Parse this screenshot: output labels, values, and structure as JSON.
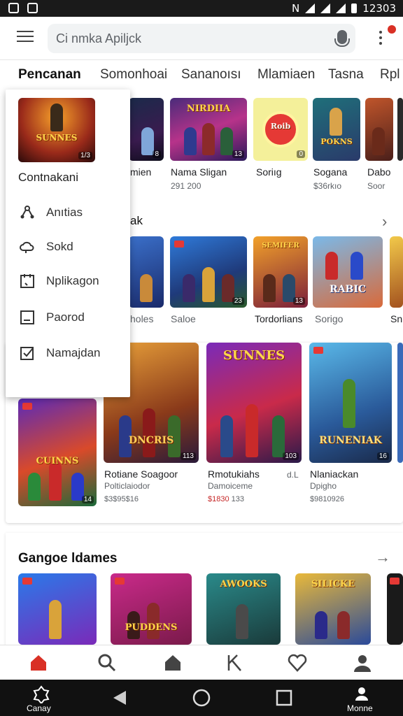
{
  "status_bar": {
    "time": "12303",
    "network": "N"
  },
  "search": {
    "placeholder": "Ci nmka Apiljck"
  },
  "tabs": [
    {
      "label": "Pencanan",
      "active": true
    },
    {
      "label": "Somonhoai"
    },
    {
      "label": "Sananoısı"
    },
    {
      "label": "Mlamiaen"
    },
    {
      "label": "Tasna"
    },
    {
      "label": "Rpl"
    }
  ],
  "popup_menu": {
    "featured_title": "SUNNES",
    "featured_tag": "1/3",
    "title": "Contnakani",
    "items": [
      {
        "label": "Anıtias",
        "icon": "share-icon"
      },
      {
        "label": "Sokd",
        "icon": "cloud-icon"
      },
      {
        "label": "Nplikagon",
        "icon": "calendar-icon"
      },
      {
        "label": "Paorod",
        "icon": "tablet-icon"
      },
      {
        "label": "Namajdan",
        "icon": "checkbox-icon"
      }
    ]
  },
  "row1": [
    {
      "title": "",
      "tag": "8",
      "name": "mien",
      "sub": ""
    },
    {
      "title": "NIRDIIA",
      "tag": "13",
      "name": "Nama Sligan",
      "sub": "291 200"
    },
    {
      "title": "Roib",
      "tag": "0",
      "name": "Soriıg",
      "sub": ""
    },
    {
      "title": "POKNS",
      "tag": "",
      "name": "Sogana",
      "sub": "$36rkıo"
    },
    {
      "title": "",
      "tag": "",
      "name": "Dabo",
      "sub": "Soor"
    }
  ],
  "row2": {
    "header": "ak",
    "items": [
      {
        "title": "",
        "tag": "",
        "name": "holes"
      },
      {
        "title": "",
        "tag": "23",
        "name": "Saloe"
      },
      {
        "title": "SEMIFER",
        "tag": "13",
        "name": "Tordorlians"
      },
      {
        "title": "RABIC",
        "tag": "",
        "name": "Sorigo"
      },
      {
        "title": "",
        "tag": "",
        "name": "Sn"
      }
    ]
  },
  "row3": [
    {
      "title": "CUINNS",
      "tag": "14",
      "name": "",
      "sub": "",
      "price": ""
    },
    {
      "title": "DNCRIS",
      "tag": "113",
      "name": "Rotiane Soagoor",
      "sub": "Polticlaiodor",
      "price": "$3$95$16"
    },
    {
      "title": "SUNNES",
      "tag": "103",
      "name": "Rmotukiahs",
      "sub": "Damoiceme",
      "price_red": "$1830",
      "price": "133",
      "extra": "d.L"
    },
    {
      "title": "RUNENIAK",
      "tag": "16",
      "name": "Nlaniackan",
      "sub": "Dpigho",
      "price": "$9810926"
    }
  ],
  "section2": {
    "title": "Gangoe ldames",
    "items": [
      {
        "title": ""
      },
      {
        "title": "PUDDENS"
      },
      {
        "title": "AWOOKS"
      },
      {
        "title": "SILICKE"
      }
    ]
  },
  "bottom_nav": [
    {
      "icon": "home-icon",
      "active": true
    },
    {
      "icon": "search-icon"
    },
    {
      "icon": "house-icon"
    },
    {
      "icon": "bookmark-icon"
    },
    {
      "icon": "heart-icon"
    },
    {
      "icon": "profile-icon"
    }
  ],
  "system_nav": {
    "left_label": "Canay",
    "right_label": "Monne"
  },
  "colors": {
    "accent": "#d93025",
    "text": "#202124",
    "muted": "#5f6368"
  }
}
